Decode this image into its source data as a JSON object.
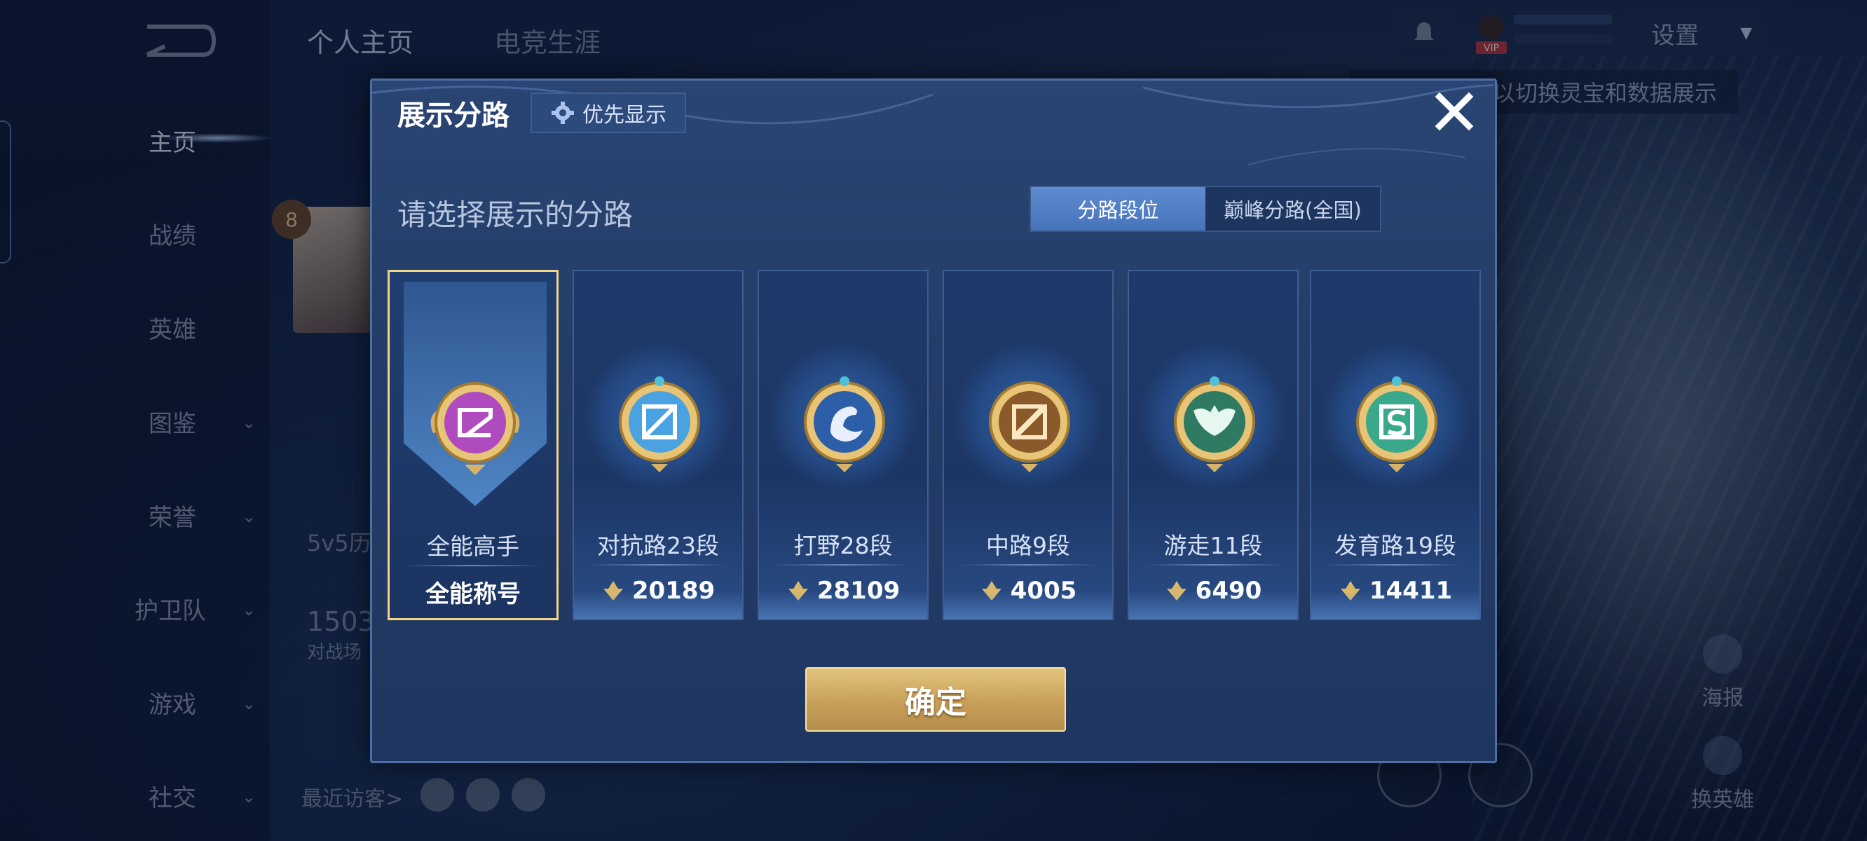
{
  "sidebar": {
    "items": [
      {
        "label": "主页",
        "has_chevron": false,
        "active": true
      },
      {
        "label": "战绩",
        "has_chevron": false
      },
      {
        "label": "英雄",
        "has_chevron": false
      },
      {
        "label": "图鉴",
        "has_chevron": true
      },
      {
        "label": "荣誉",
        "has_chevron": true
      },
      {
        "label": "护卫队",
        "has_chevron": true
      },
      {
        "label": "游戏",
        "has_chevron": true
      },
      {
        "label": "社交",
        "has_chevron": true
      }
    ]
  },
  "header": {
    "tabs": [
      {
        "label": "个人主页"
      },
      {
        "label": "电竞生涯"
      }
    ],
    "settings_label": "设置",
    "vip_label": "VIP",
    "tip_text": "以切换灵宝和数据展示"
  },
  "background": {
    "level": "8",
    "stat_label": "5v5历",
    "stat_number": "1503",
    "stat_sub": "对战场",
    "recent_visitors": "最近访客>",
    "poster_label": "海报",
    "switch_hero_label": "换英雄"
  },
  "modal": {
    "title": "展示分路",
    "priority_label": "优先显示",
    "subtitle": "请选择展示的分路",
    "segment_tabs": [
      {
        "label": "分路段位",
        "active": true
      },
      {
        "label": "巅峰分路(全国)",
        "active": false
      }
    ],
    "cards": [
      {
        "name": "全能高手",
        "value": "全能称号",
        "selected": true,
        "emblem": "all-round-emblem-icon",
        "color": "#b04bbf"
      },
      {
        "name": "对抗路23段",
        "value": "20189",
        "selected": false,
        "emblem": "clash-lane-emblem-icon",
        "color": "#4aa3e0"
      },
      {
        "name": "打野28段",
        "value": "28109",
        "selected": false,
        "emblem": "jungle-emblem-icon",
        "color": "#2d5fa8"
      },
      {
        "name": "中路9段",
        "value": "4005",
        "selected": false,
        "emblem": "mid-lane-emblem-icon",
        "color": "#8a5a2a"
      },
      {
        "name": "游走11段",
        "value": "6490",
        "selected": false,
        "emblem": "roam-emblem-icon",
        "color": "#2f7a63"
      },
      {
        "name": "发育路19段",
        "value": "14411",
        "selected": false,
        "emblem": "farm-lane-emblem-icon",
        "color": "#3aa88a"
      }
    ],
    "confirm_label": "确定"
  },
  "colors": {
    "accent_gold": "#f2d489",
    "modal_bg": "#243d68",
    "segment_active": "#4f7fc4"
  }
}
